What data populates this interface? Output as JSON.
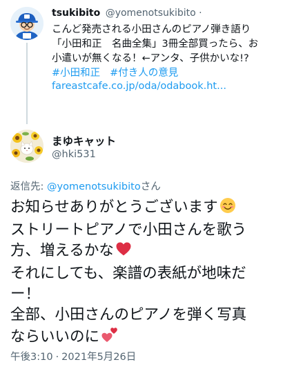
{
  "parent_tweet": {
    "display_name": "tsukibito",
    "handle": "@yomenotsukibito",
    "separator": "·",
    "text_lines": [
      "こんど発売される小田さんのピアノ弾き語り",
      "「小田和正　名曲全集」3冊全部買ったら、お",
      "小遣いが無くなる！←アンタ、子供かいな!?"
    ],
    "hashtags": [
      "#小田和正",
      "#付き人の意見"
    ],
    "link": "fareastcafe.co.jp/oda/odabook.ht..."
  },
  "reply_tweet": {
    "display_name": "まゆキャット",
    "handle": "@hki531",
    "reply_prefix": "返信先: ",
    "reply_handle": "@yomenotsukibito",
    "reply_suffix": "さん",
    "text_lines": [
      "お知らせありがとうございます",
      "ストリートピアノで小田さんを歌う",
      "方、増えるかな",
      "それにしても、楽譜の表紙が地味だ",
      "ー！",
      "全部、小田さんのピアノを弾く写真",
      "ならいいのに"
    ],
    "emoji_names": [
      "smiling-face-emoji",
      "red-heart-emoji",
      "two-hearts-emoji"
    ],
    "time": "午後3:10",
    "date_separator": "·",
    "date": "2021年5月26日"
  }
}
